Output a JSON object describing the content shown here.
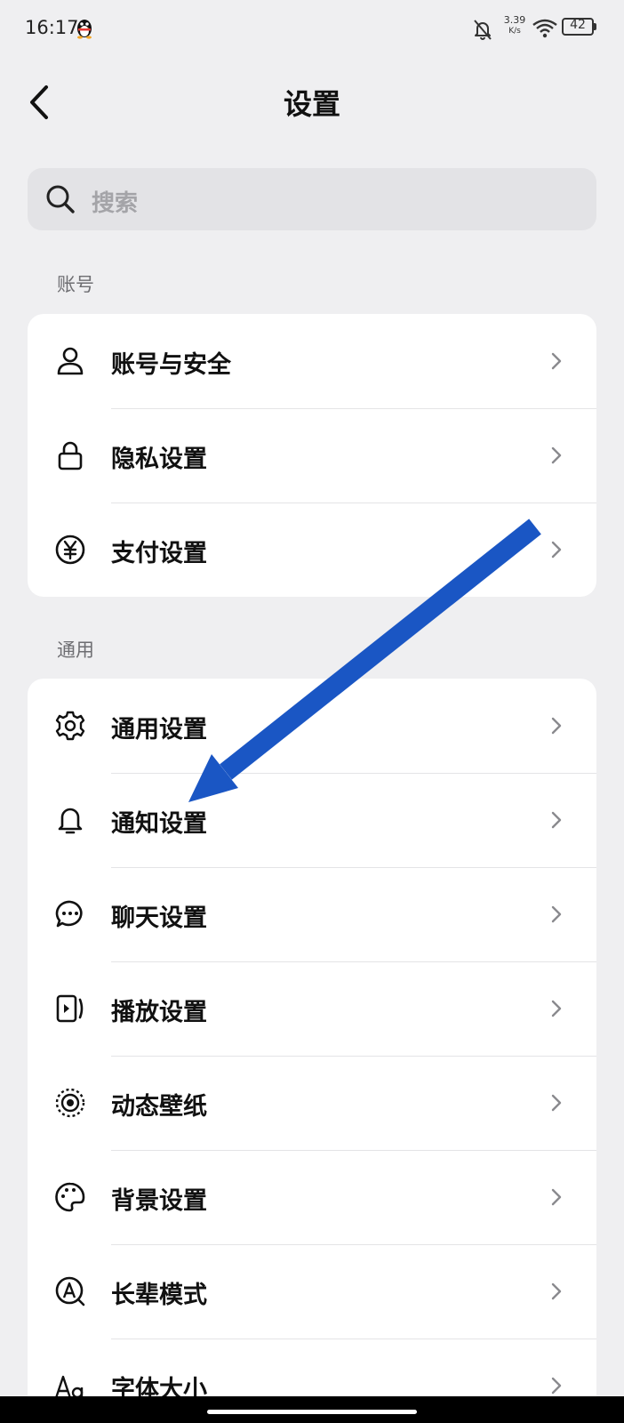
{
  "status_bar": {
    "time": "16:17",
    "net_speed_value": "3.39",
    "net_speed_unit": "K/s",
    "battery": "42",
    "icons": [
      "qq-icon",
      "bell-off-icon",
      "wifi-icon",
      "battery-icon"
    ]
  },
  "nav": {
    "title": "设置",
    "back_icon": "chevron-left-icon"
  },
  "search": {
    "placeholder": "搜索",
    "icon": "search-icon"
  },
  "sections": [
    {
      "label": "账号",
      "items": [
        {
          "label": "账号与安全",
          "icon": "user-icon"
        },
        {
          "label": "隐私设置",
          "icon": "lock-icon"
        },
        {
          "label": "支付设置",
          "icon": "yen-icon"
        }
      ]
    },
    {
      "label": "通用",
      "items": [
        {
          "label": "通用设置",
          "icon": "gear-icon"
        },
        {
          "label": "通知设置",
          "icon": "bell-icon"
        },
        {
          "label": "聊天设置",
          "icon": "chat-bubble-icon"
        },
        {
          "label": "播放设置",
          "icon": "play-screen-icon"
        },
        {
          "label": "动态壁纸",
          "icon": "dynamic-wallpaper-icon"
        },
        {
          "label": "背景设置",
          "icon": "palette-icon"
        },
        {
          "label": "长辈模式",
          "icon": "elder-mode-icon"
        },
        {
          "label": "字体大小",
          "icon": "font-size-icon"
        }
      ]
    }
  ],
  "colors": {
    "page_background": "#efeff1",
    "card_background": "#ffffff",
    "annotation_arrow": "#1a56c4"
  }
}
